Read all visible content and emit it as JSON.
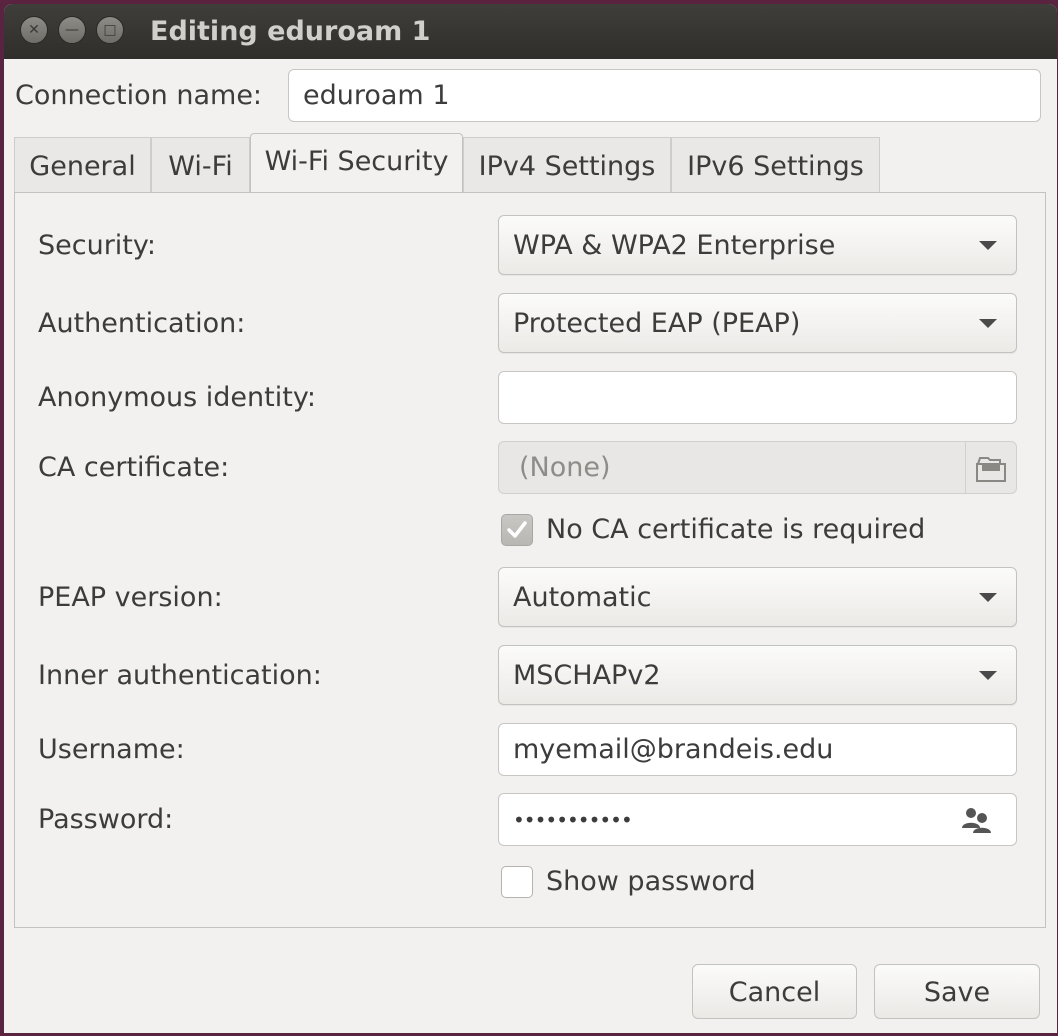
{
  "window": {
    "title": "Editing eduroam 1",
    "close_glyph": "✕",
    "minimize_glyph": "—",
    "maximize_glyph": "□"
  },
  "connection": {
    "label": "Connection name:",
    "value": "eduroam 1"
  },
  "tabs": [
    {
      "label": "General",
      "active": false
    },
    {
      "label": "Wi-Fi",
      "active": false
    },
    {
      "label": "Wi-Fi Security",
      "active": true
    },
    {
      "label": "IPv4 Settings",
      "active": false
    },
    {
      "label": "IPv6 Settings",
      "active": false
    }
  ],
  "form": {
    "security": {
      "label": "Security:",
      "value": "WPA & WPA2 Enterprise"
    },
    "authentication": {
      "label": "Authentication:",
      "value": "Protected EAP (PEAP)"
    },
    "anonymous_identity": {
      "label": "Anonymous identity:",
      "value": ""
    },
    "ca_certificate": {
      "label": "CA certificate:",
      "value": "(None)",
      "icon": "file-chooser-icon"
    },
    "no_ca_required": {
      "label": "No CA certificate is required",
      "checked": true
    },
    "peap_version": {
      "label": "PEAP version:",
      "value": "Automatic"
    },
    "inner_authentication": {
      "label": "Inner authentication:",
      "value": "MSCHAPv2"
    },
    "username": {
      "label": "Username:",
      "value": "myemail@brandeis.edu"
    },
    "password": {
      "label": "Password:",
      "value": "•••••••••••",
      "icon": "users-icon"
    },
    "show_password": {
      "label": "Show password",
      "checked": false
    }
  },
  "buttons": {
    "cancel": "Cancel",
    "save": "Save"
  },
  "colors": {
    "desktop": "#5a2440",
    "titlebar": "#3a3935",
    "dialog": "#f2f1f0"
  }
}
